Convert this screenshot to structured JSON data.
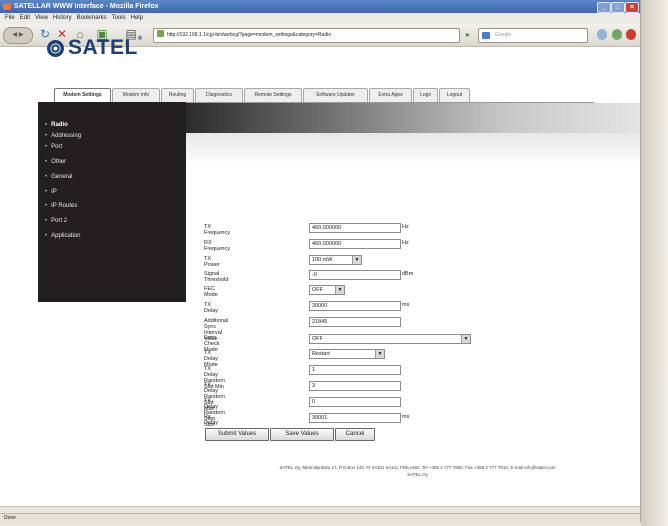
{
  "window": {
    "title": "SATELLAR WWW Interface - Mozilla Firefox"
  },
  "menu": [
    "File",
    "Edit",
    "View",
    "History",
    "Bookmarks",
    "Tools",
    "Help"
  ],
  "nav": {
    "url": "http://192.168.1.1/cgi-bin/webcgi?page=modem_settings&category=Radio",
    "search_placeholder": "Google"
  },
  "brand": {
    "name": "SATEL",
    "tm": "®"
  },
  "tabs": [
    {
      "label": "Modem Settings",
      "active": true
    },
    {
      "label": "Modem Info",
      "active": false
    },
    {
      "label": "Routing",
      "active": false
    },
    {
      "label": "Diagnostics",
      "active": false
    },
    {
      "label": "Remote Settings",
      "active": false
    },
    {
      "label": "Software Updater",
      "active": false
    },
    {
      "label": "Extra Apps",
      "active": false
    },
    {
      "label": "Logs",
      "active": false
    },
    {
      "label": "Logout",
      "active": false
    }
  ],
  "sidebar": [
    {
      "label": "Radio",
      "active": true
    },
    {
      "label": "Addressing",
      "active": false
    },
    {
      "label": "Port",
      "active": false
    },
    {
      "label": "Other",
      "active": false
    },
    {
      "label": "General",
      "active": false
    },
    {
      "label": "IP",
      "active": false
    },
    {
      "label": "IP Routes",
      "active": false
    },
    {
      "label": "Port 2",
      "active": false
    },
    {
      "label": "Application",
      "active": false
    }
  ],
  "form": {
    "rows": [
      {
        "label": "TX Frequency",
        "value": "460.000000",
        "unit": "Hz",
        "type": "input"
      },
      {
        "label": "RX Frequency",
        "value": "460.000000",
        "unit": "Hz",
        "type": "input"
      },
      {
        "label": "TX Power",
        "value": "100 mW",
        "unit": "",
        "type": "select"
      },
      {
        "label": "Signal Threshold",
        "value": "-0",
        "unit": "dBm",
        "type": "input"
      },
      {
        "label": "FEC Mode",
        "value": "OFF",
        "unit": "",
        "type": "select"
      },
      {
        "label": "TX Delay",
        "value": "20000",
        "unit": "ms",
        "type": "input"
      },
      {
        "label": "Additional Sync Interval Value",
        "value": "21845",
        "unit": "",
        "type": "input"
      },
      {
        "label": "Error Check Mode",
        "value": "OFF",
        "unit": "",
        "type": "select"
      },
      {
        "label": "TX Delay Mode",
        "value": "Restart",
        "unit": "",
        "type": "select"
      },
      {
        "label": "TX Delay Random Slot Min",
        "value": "1",
        "unit": "",
        "type": "input"
      },
      {
        "label": "TX Delay Random Slot Max",
        "value": "3",
        "unit": "",
        "type": "input"
      },
      {
        "label": "TX Delay Random Step Size",
        "value": "0",
        "unit": "",
        "type": "input"
      },
      {
        "label": "Rx Delay",
        "value": "30001",
        "unit": "ms",
        "type": "input"
      }
    ],
    "buttons": {
      "submit": "Submit Values",
      "save": "Save Values",
      "cancel": "Cancel"
    }
  },
  "footer": {
    "line1": "SATEL Oy, Meriniitynkatu 17, P.O.Box 142, FI-24101 SALO, FINLAND, Tel +358 2 777 7800, Fax +358 2 777 7810, E-mail info@satel.com",
    "line2": "SATEL Oy"
  },
  "status": {
    "text": "Done"
  }
}
